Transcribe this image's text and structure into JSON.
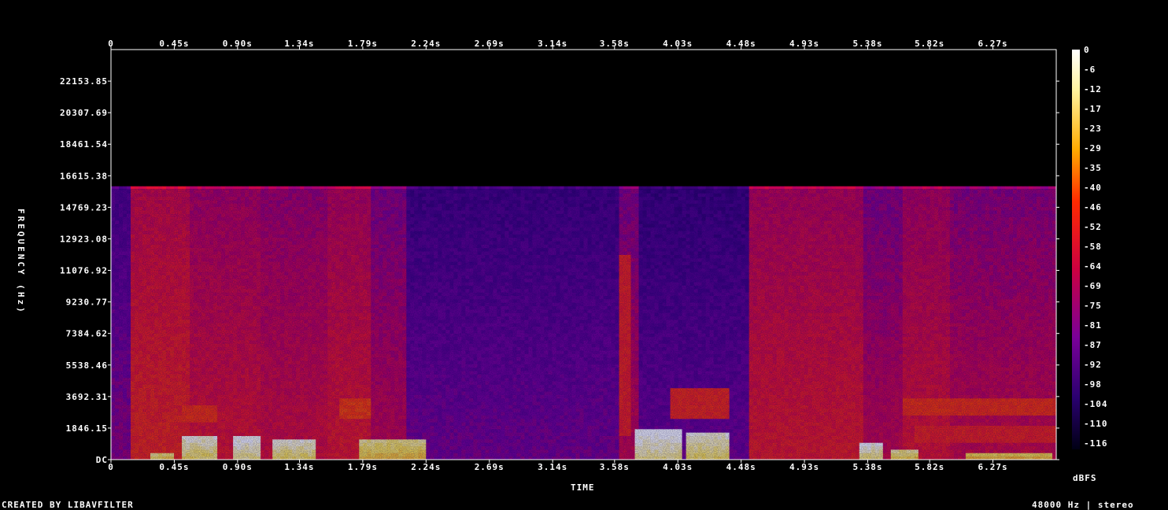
{
  "chart_data": {
    "type": "heatmap",
    "title": "",
    "xlabel": "TIME",
    "ylabel": "FREQUENCY (Hz)",
    "x_ticks": [
      "0",
      "0.45s",
      "0.90s",
      "1.34s",
      "1.79s",
      "2.24s",
      "2.69s",
      "3.14s",
      "3.58s",
      "4.03s",
      "4.48s",
      "4.93s",
      "5.38s",
      "5.82s",
      "6.27s"
    ],
    "y_ticks": [
      "DC",
      "1846.15",
      "3692.31",
      "5538.46",
      "7384.62",
      "9230.77",
      "11076.92",
      "12923.08",
      "14769.23",
      "16615.38",
      "18461.54",
      "20307.69",
      "22153.85"
    ],
    "xlim": [
      0,
      6.72
    ],
    "ylim": [
      0,
      24000
    ],
    "colorbar": {
      "label": "dBFS",
      "ticks": [
        "0",
        "-6",
        "-12",
        "-17",
        "-23",
        "-29",
        "-35",
        "-40",
        "-46",
        "-52",
        "-58",
        "-64",
        "-69",
        "-75",
        "-81",
        "-87",
        "-92",
        "-98",
        "-104",
        "-110",
        "-116"
      ],
      "range": [
        -120,
        0
      ]
    },
    "lowpass_cutoff_hz": 16000,
    "segments": [
      {
        "start": 0.0,
        "end": 0.15,
        "level": -82
      },
      {
        "start": 0.15,
        "end": 0.55,
        "level": -55
      },
      {
        "start": 0.55,
        "end": 1.05,
        "level": -62
      },
      {
        "start": 1.05,
        "end": 1.55,
        "level": -65
      },
      {
        "start": 1.55,
        "end": 1.85,
        "level": -60
      },
      {
        "start": 1.85,
        "end": 2.1,
        "level": -70
      },
      {
        "start": 2.1,
        "end": 3.6,
        "level": -86
      },
      {
        "start": 3.6,
        "end": 3.75,
        "level": -70
      },
      {
        "start": 3.75,
        "end": 4.55,
        "level": -88
      },
      {
        "start": 4.55,
        "end": 5.35,
        "level": -60
      },
      {
        "start": 5.35,
        "end": 5.62,
        "level": -70
      },
      {
        "start": 5.62,
        "end": 5.95,
        "level": -62
      },
      {
        "start": 5.95,
        "end": 6.72,
        "level": -68
      }
    ],
    "bursts": [
      {
        "start": 0.27,
        "end": 0.45,
        "fmax": 500,
        "level": -18
      },
      {
        "start": 0.5,
        "end": 0.76,
        "fmax": 1400,
        "level": -14
      },
      {
        "start": 0.88,
        "end": 1.05,
        "fmax": 1500,
        "level": -10
      },
      {
        "start": 1.16,
        "end": 1.45,
        "fmax": 1200,
        "level": -14
      },
      {
        "start": 1.77,
        "end": 2.24,
        "fmax": 1300,
        "level": -20
      },
      {
        "start": 3.73,
        "end": 4.05,
        "fmax": 1800,
        "level": -10
      },
      {
        "start": 4.1,
        "end": 4.4,
        "fmax": 1600,
        "level": -14
      },
      {
        "start": 5.33,
        "end": 5.5,
        "fmax": 1000,
        "level": -12
      },
      {
        "start": 5.55,
        "end": 5.75,
        "fmax": 700,
        "level": -18
      },
      {
        "start": 6.08,
        "end": 6.7,
        "fmax": 500,
        "level": -22
      }
    ],
    "bands": [
      {
        "start": 0.5,
        "end": 0.76,
        "fmin": 2200,
        "fmax": 3200,
        "level": -45
      },
      {
        "start": 1.62,
        "end": 1.85,
        "fmin": 2500,
        "fmax": 3700,
        "level": -42
      },
      {
        "start": 3.62,
        "end": 3.7,
        "fmin": 1500,
        "fmax": 12000,
        "level": -50
      },
      {
        "start": 3.97,
        "end": 4.4,
        "fmin": 2400,
        "fmax": 4300,
        "level": -48
      },
      {
        "start": 5.62,
        "end": 6.72,
        "fmin": 2600,
        "fmax": 3700,
        "level": -45
      },
      {
        "start": 5.7,
        "end": 6.72,
        "fmin": 1000,
        "fmax": 2000,
        "level": -50
      }
    ]
  },
  "footer": {
    "credit": "CREATED BY LIBAVFILTER",
    "info": "48000 Hz | stereo"
  }
}
